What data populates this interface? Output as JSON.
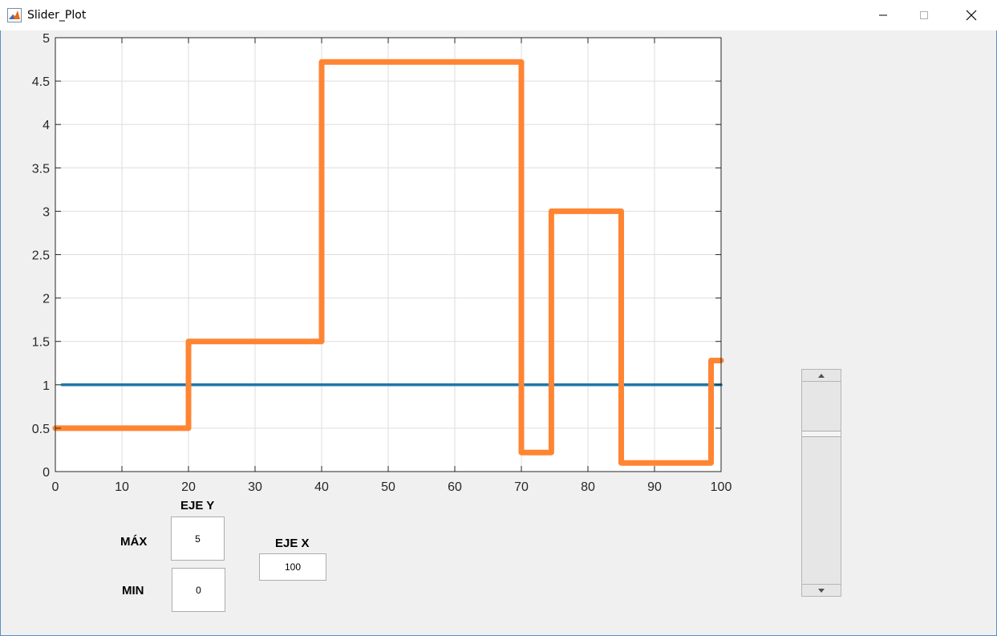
{
  "window": {
    "title": "Slider_Plot",
    "icon": "matlab-icon",
    "controls": [
      "minimize-icon",
      "maximize-icon",
      "close-icon"
    ]
  },
  "chart_data": {
    "type": "line",
    "title": "",
    "xlabel": "",
    "ylabel": "",
    "xlim": [
      0,
      100
    ],
    "ylim": [
      0,
      5
    ],
    "xticks": [
      0,
      10,
      20,
      30,
      40,
      50,
      60,
      70,
      80,
      90,
      100
    ],
    "yticks": [
      0,
      0.5,
      1,
      1.5,
      2,
      2.5,
      3,
      3.5,
      4,
      4.5,
      5
    ],
    "grid": true,
    "series": [
      {
        "color": "#1f77a8",
        "x": [
          1,
          100
        ],
        "y": [
          1,
          1
        ]
      },
      {
        "color": "#ff8533",
        "step": true,
        "x": [
          0,
          20,
          20,
          40,
          40,
          70,
          70,
          74.5,
          74.5,
          85,
          85,
          98.5,
          98.5,
          100
        ],
        "y": [
          0.5,
          0.5,
          1.5,
          1.5,
          4.72,
          4.72,
          0.22,
          0.22,
          3.0,
          3.0,
          0.1,
          0.1,
          1.28,
          1.28
        ]
      }
    ]
  },
  "controls": {
    "eje_y_label": "EJE Y",
    "max_label": "MÁX",
    "min_label": "MIN",
    "max_value": "5",
    "min_value": "0",
    "eje_x_label": "EJE X",
    "x_value": "100"
  },
  "slider": {
    "value_fraction": 0.75
  }
}
